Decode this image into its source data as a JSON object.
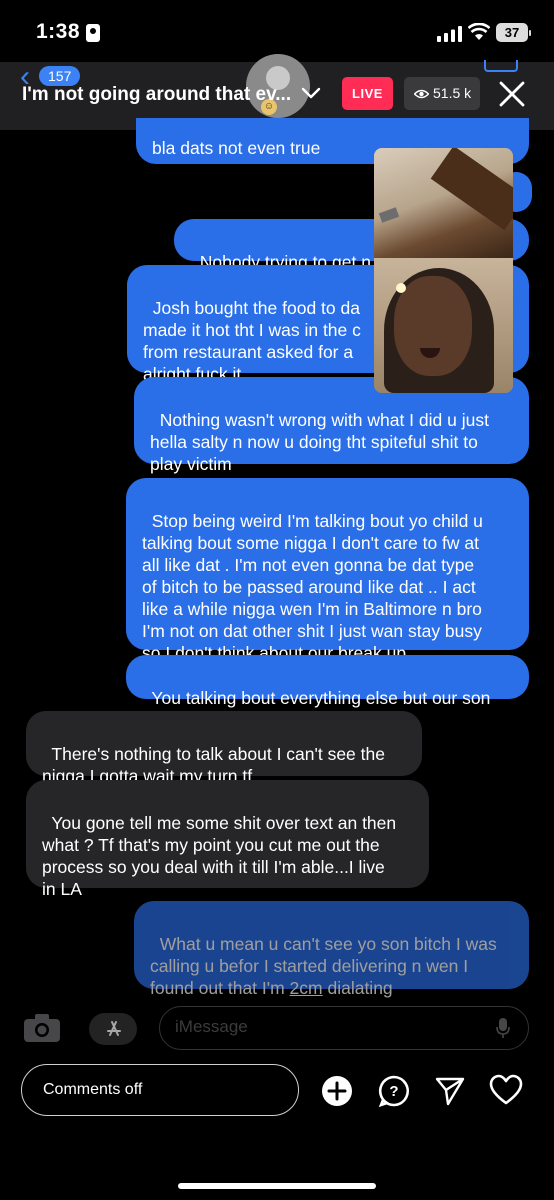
{
  "status_bar": {
    "time": "1:38",
    "battery": "37"
  },
  "header": {
    "unread_count": "157",
    "title": "I'm not going around that ev...",
    "live_label": "LIVE",
    "viewer_count": "51.5 k"
  },
  "messages": [
    {
      "dir": "out",
      "text": "bla dats not even true"
    },
    {
      "dir": "out",
      "text": "Nobody trying to get n"
    },
    {
      "dir": "out",
      "text": "Josh bought the food to da\nmade it hot tht I was in the c\nfrom restaurant asked for a\nalright fuck it"
    },
    {
      "dir": "out",
      "text": "Nothing wasn't wrong with what I did u just\nhella salty n now u doing tht spiteful shit to\nplay victim"
    },
    {
      "dir": "out",
      "text": "Stop being weird I'm talking bout yo child u\ntalking bout some nigga I don't care to fw at\nall like dat . I'm not even gonna be dat type\nof bitch to be passed around like dat .. I act\nlike a while nigga wen I'm in Baltimore n bro\nI'm not on dat other shit I just wan stay busy\nso I don't think about our break up"
    },
    {
      "dir": "out",
      "text": "You talking bout everything else but our son"
    },
    {
      "dir": "in",
      "text": "There's nothing to talk about I can't see the\nnigga I gotta wait my turn tf"
    },
    {
      "dir": "in",
      "text": "You gone tell me some shit over text an then\nwhat ? Tf that's my point you cut me out the\nprocess so you deal with it till I'm able...I live\nin LA"
    },
    {
      "dir": "out",
      "text_before": "What u mean u can't see yo son bitch I was\ncalling u befor I started delivering n wen I\nfound out that I'm ",
      "text_link": "2cm",
      "text_after": " dialating"
    }
  ],
  "compose": {
    "placeholder": "iMessage"
  },
  "bottom_bar": {
    "comment_label": "Comments off"
  },
  "colors": {
    "live": "#ff2d55",
    "outgoing_bubble": "#2a6fe8",
    "incoming_bubble": "#262628",
    "accent": "#3b82f6"
  }
}
